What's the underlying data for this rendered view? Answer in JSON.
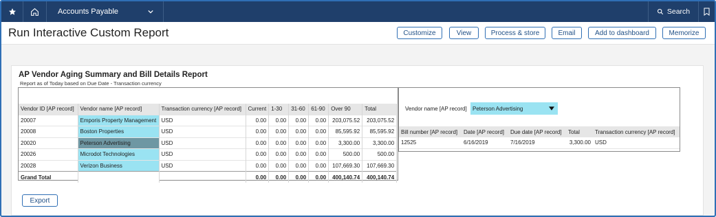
{
  "nav": {
    "app_name": "Accounts Payable",
    "search_label": "Search",
    "icons": [
      "star-icon",
      "home-icon",
      "chevron-down-icon",
      "search-icon",
      "bookmark-icon"
    ]
  },
  "header": {
    "title": "Run Interactive Custom Report",
    "buttons": {
      "customize": "Customize",
      "view": "View",
      "process_store": "Process & store",
      "email": "Email",
      "add_dashboard": "Add to dashboard",
      "memorize": "Memorize"
    }
  },
  "report": {
    "title": "AP Vendor Aging Summary and Bill Details Report",
    "subtitle": "Report as of Today based on Due Date - Transaction currency",
    "columns": [
      "Vendor ID [AP record]",
      "Vendor name [AP record]",
      "Transaction currency [AP record]",
      "Current",
      "1-30",
      "31-60",
      "61-90",
      "Over 90",
      "Total"
    ],
    "rows": [
      {
        "id": "20007",
        "name": "Emporis Property Management",
        "currency": "USD",
        "current": "0.00",
        "d1_30": "0.00",
        "d31_60": "0.00",
        "d61_90": "0.00",
        "over90": "203,075.52",
        "total": "203,075.52"
      },
      {
        "id": "20008",
        "name": "Boston Properties",
        "currency": "USD",
        "current": "0.00",
        "d1_30": "0.00",
        "d31_60": "0.00",
        "d61_90": "0.00",
        "over90": "85,595.92",
        "total": "85,595.92"
      },
      {
        "id": "20020",
        "name": "Peterson Advertising",
        "currency": "USD",
        "current": "0.00",
        "d1_30": "0.00",
        "d31_60": "0.00",
        "d61_90": "0.00",
        "over90": "3,300.00",
        "total": "3,300.00"
      },
      {
        "id": "20026",
        "name": "Microdot Technologies",
        "currency": "USD",
        "current": "0.00",
        "d1_30": "0.00",
        "d31_60": "0.00",
        "d61_90": "0.00",
        "over90": "500.00",
        "total": "500.00"
      },
      {
        "id": "20028",
        "name": "Verizon Business",
        "currency": "USD",
        "current": "0.00",
        "d1_30": "0.00",
        "d31_60": "0.00",
        "d61_90": "0.00",
        "over90": "107,669.30",
        "total": "107,669.30"
      }
    ],
    "grand_total": {
      "label": "Grand Total",
      "current": "0.00",
      "d1_30": "0.00",
      "d31_60": "0.00",
      "d61_90": "0.00",
      "over90": "400,140.74",
      "total": "400,140.74"
    },
    "selected_vendor": "Peterson Advertising"
  },
  "details": {
    "filter_label": "Vendor name [AP record]",
    "filter_value": "Peterson Advertising",
    "columns": [
      "Bill number [AP record]",
      "Date [AP record]",
      "Due date [AP record]",
      "Total",
      "Transaction currency [AP record]"
    ],
    "rows": [
      {
        "bill": "12525",
        "date": "6/16/2019",
        "due": "7/16/2019",
        "total": "3,300.00",
        "currency": "USD"
      }
    ]
  },
  "footer": {
    "export_label": "Export"
  },
  "colors": {
    "nav_bg": "#1f3f6b",
    "accent": "#2f6fb5",
    "highlight": "#9ae3f2",
    "selected": "#6e97a3"
  }
}
